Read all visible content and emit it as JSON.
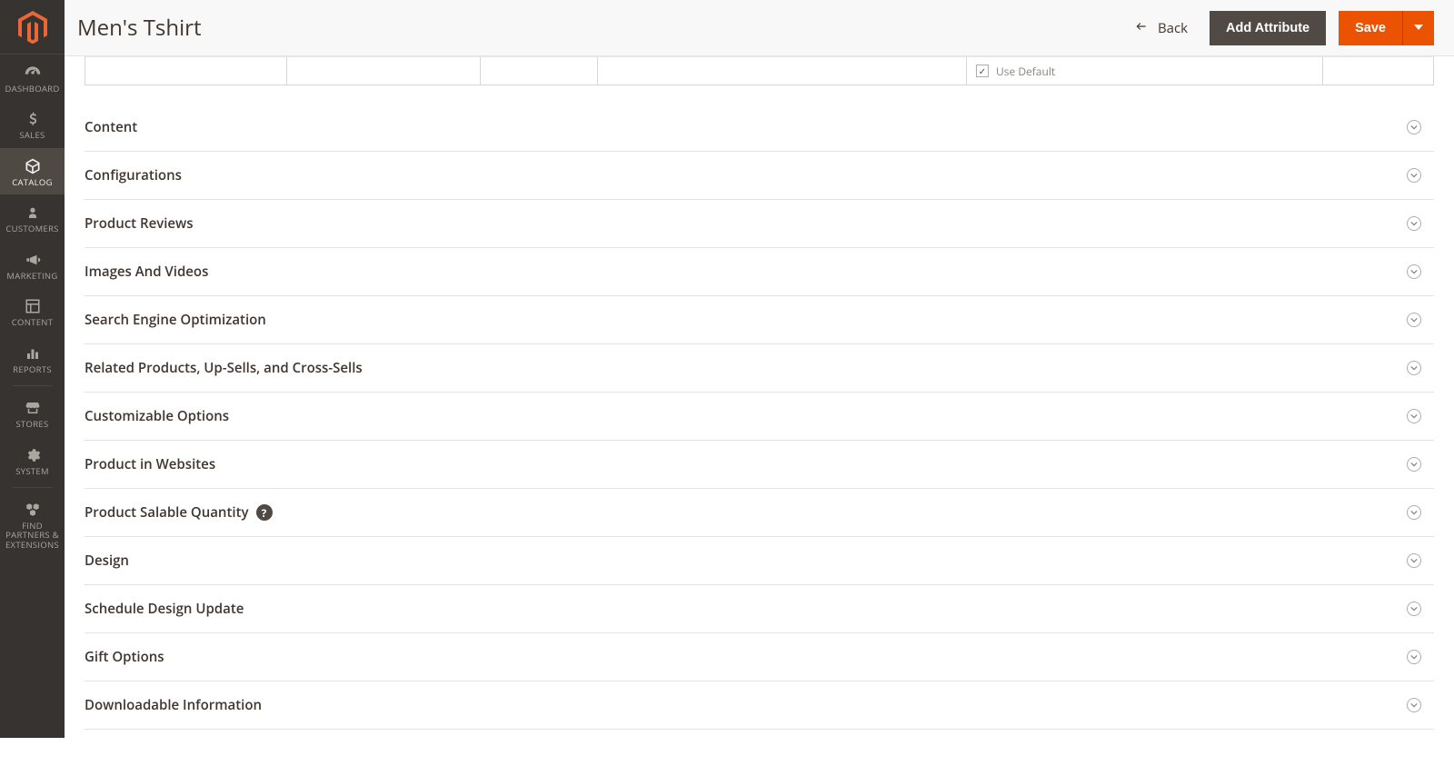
{
  "page_title": "Men's Tshirt",
  "header": {
    "back_label": "Back",
    "add_attribute_label": "Add Attribute",
    "save_label": "Save"
  },
  "use_default_label": "Use Default",
  "sidebar": {
    "items": [
      {
        "label": "DASHBOARD",
        "icon": "gauge"
      },
      {
        "label": "SALES",
        "icon": "dollar"
      },
      {
        "label": "CATALOG",
        "icon": "cube",
        "active": true
      },
      {
        "label": "CUSTOMERS",
        "icon": "person"
      },
      {
        "label": "MARKETING",
        "icon": "megaphone"
      },
      {
        "label": "CONTENT",
        "icon": "layout"
      },
      {
        "label": "REPORTS",
        "icon": "bars"
      },
      {
        "label": "STORES",
        "icon": "storefront"
      },
      {
        "label": "SYSTEM",
        "icon": "gear"
      },
      {
        "label": "FIND PARTNERS & EXTENSIONS",
        "icon": "boxes"
      }
    ]
  },
  "sections": [
    {
      "title": "Content"
    },
    {
      "title": "Configurations"
    },
    {
      "title": "Product Reviews"
    },
    {
      "title": "Images And Videos"
    },
    {
      "title": "Search Engine Optimization"
    },
    {
      "title": "Related Products, Up-Sells, and Cross-Sells"
    },
    {
      "title": "Customizable Options"
    },
    {
      "title": "Product in Websites"
    },
    {
      "title": "Product Salable Quantity",
      "help": true
    },
    {
      "title": "Design"
    },
    {
      "title": "Schedule Design Update"
    },
    {
      "title": "Gift Options"
    },
    {
      "title": "Downloadable Information"
    }
  ]
}
